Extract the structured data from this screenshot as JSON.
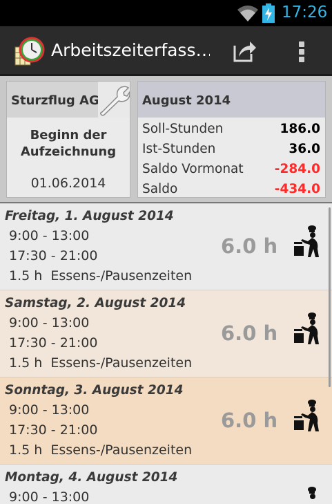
{
  "status_bar": {
    "time": "17:26"
  },
  "action_bar": {
    "title": "Arbeitszeiterfass…",
    "icons": [
      "app-clock-calendar-icon",
      "share-icon",
      "overflow-menu-icon"
    ]
  },
  "summary": {
    "company": "Sturzflug AG",
    "beginn_label_line1": "Beginn der",
    "beginn_label_line2": "Aufzeichnung",
    "beginn_date": "01.06.2014",
    "month": "August 2014",
    "stats": [
      {
        "label": "Soll-Stunden",
        "value": "186.0",
        "color": "#000000"
      },
      {
        "label": "Ist-Stunden",
        "value": "36.0",
        "color": "#000000"
      },
      {
        "label": "Saldo Vormonat",
        "value": "-284.0",
        "color": "#ff2a2a"
      },
      {
        "label": "Saldo",
        "value": "-434.0",
        "color": "#ff2a2a"
      }
    ]
  },
  "days": [
    {
      "title": "Freitag, 1. August 2014",
      "line1": "9:00 - 13:00",
      "line2": "17:30 - 21:00",
      "pause_hours": "1.5 h",
      "pause_label": "Essens-/Pausenzeiten",
      "total": "6.0 h",
      "bg": "#ebebeb"
    },
    {
      "title": "Samstag, 2. August 2014",
      "line1": "9:00 - 13:00",
      "line2": "17:30 - 21:00",
      "pause_hours": "1.5 h",
      "pause_label": "Essens-/Pausenzeiten",
      "total": "6.0 h",
      "bg": "#f1e6d9"
    },
    {
      "title": "Sonntag, 3. August 2014",
      "line1": "9:00 - 13:00",
      "line2": "17:30 - 21:00",
      "pause_hours": "1.5 h",
      "pause_label": "Essens-/Pausenzeiten",
      "total": "6.0 h",
      "bg": "#f4dcc2"
    },
    {
      "title": "Montag, 4. August 2014",
      "line1": "9:00 - 13:00",
      "line2": "",
      "pause_hours": "",
      "pause_label": "",
      "total": "",
      "bg": "#ebebeb"
    }
  ]
}
